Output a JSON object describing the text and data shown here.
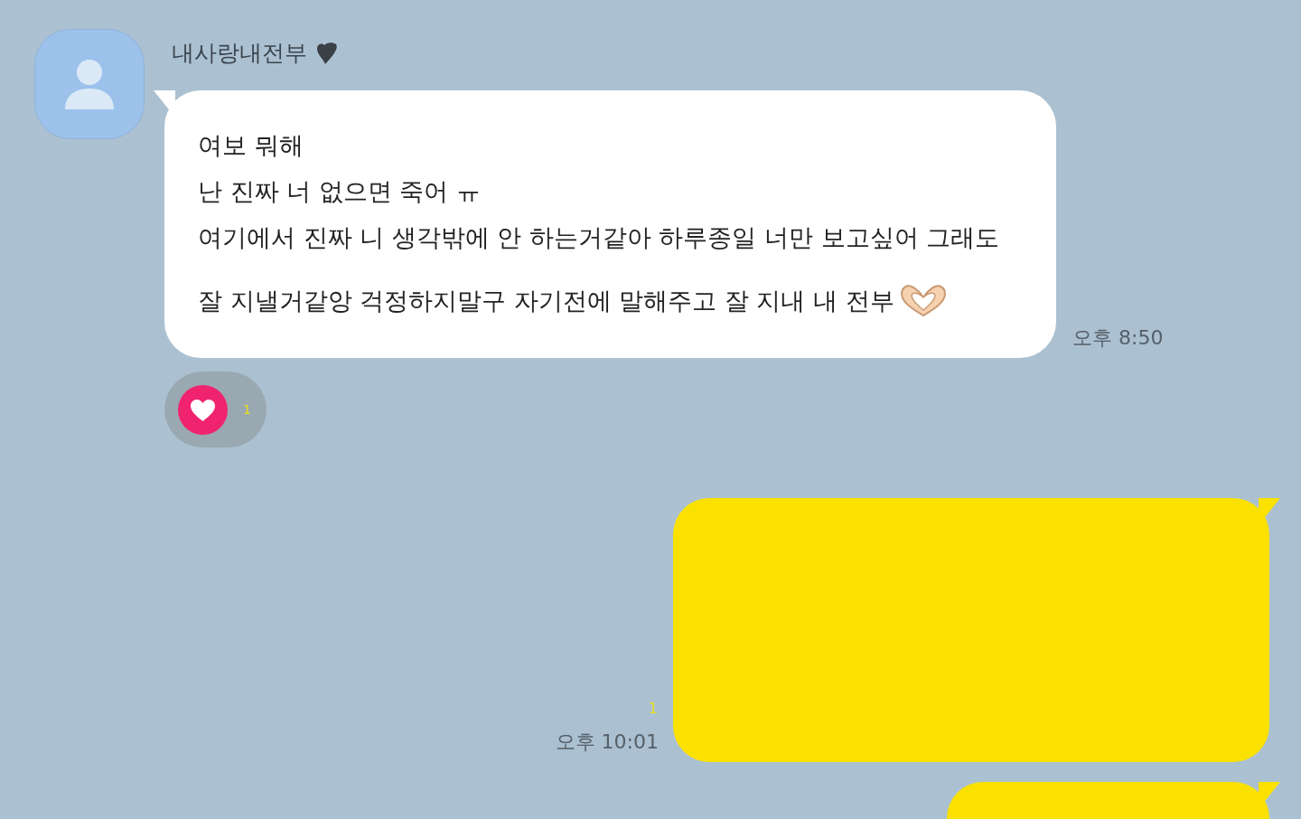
{
  "contact": {
    "name": "내사랑내전부"
  },
  "messages": [
    {
      "kind": "received",
      "lines": [
        "여보 뭐해",
        "난 진짜 너 없으면 죽어 ㅠ",
        "여기에서 진짜 니 생각밖에 안 하는거같아 하루종일 너만 보고싶어 그래도",
        "잘 지낼거같앙 걱정하지말구 자기전에 말해주고 잘 지내 내 전부"
      ],
      "time": "오후 8:50",
      "reaction": {
        "count": "1"
      }
    },
    {
      "kind": "sent",
      "time": "오후 10:01",
      "unread": "1"
    },
    {
      "kind": "sent"
    }
  ]
}
